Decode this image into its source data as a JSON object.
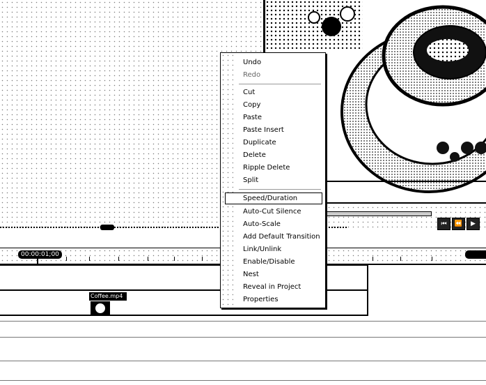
{
  "timeline": {
    "timecode": "00:00:01;00",
    "clip_label": "Coffee.mp4"
  },
  "transport": {
    "buttons": [
      {
        "icon": "skip-to-start-icon",
        "glyph": "⏮"
      },
      {
        "icon": "step-back-icon",
        "glyph": "⏪"
      },
      {
        "icon": "play-icon",
        "glyph": "▶"
      }
    ]
  },
  "context_menu": {
    "highlighted": "Speed/Duration",
    "items": [
      {
        "label": "Undo",
        "enabled": true
      },
      {
        "label": "Redo",
        "enabled": false
      },
      {
        "label": "Cut",
        "enabled": true
      },
      {
        "label": "Copy",
        "enabled": true
      },
      {
        "label": "Paste",
        "enabled": true
      },
      {
        "label": "Paste Insert",
        "enabled": true
      },
      {
        "label": "Duplicate",
        "enabled": true
      },
      {
        "label": "Delete",
        "enabled": true
      },
      {
        "label": "Ripple Delete",
        "enabled": true
      },
      {
        "label": "Split",
        "enabled": true
      },
      {
        "label": "Speed/Duration",
        "enabled": true
      },
      {
        "label": "Auto-Cut Silence",
        "enabled": true
      },
      {
        "label": "Auto-Scale",
        "enabled": true
      },
      {
        "label": "Add Default Transition",
        "enabled": true
      },
      {
        "label": "Link/Unlink",
        "enabled": true
      },
      {
        "label": "Enable/Disable",
        "enabled": true
      },
      {
        "label": "Nest",
        "enabled": true
      },
      {
        "label": "Reveal in Project",
        "enabled": true
      },
      {
        "label": "Properties",
        "enabled": true
      }
    ]
  }
}
